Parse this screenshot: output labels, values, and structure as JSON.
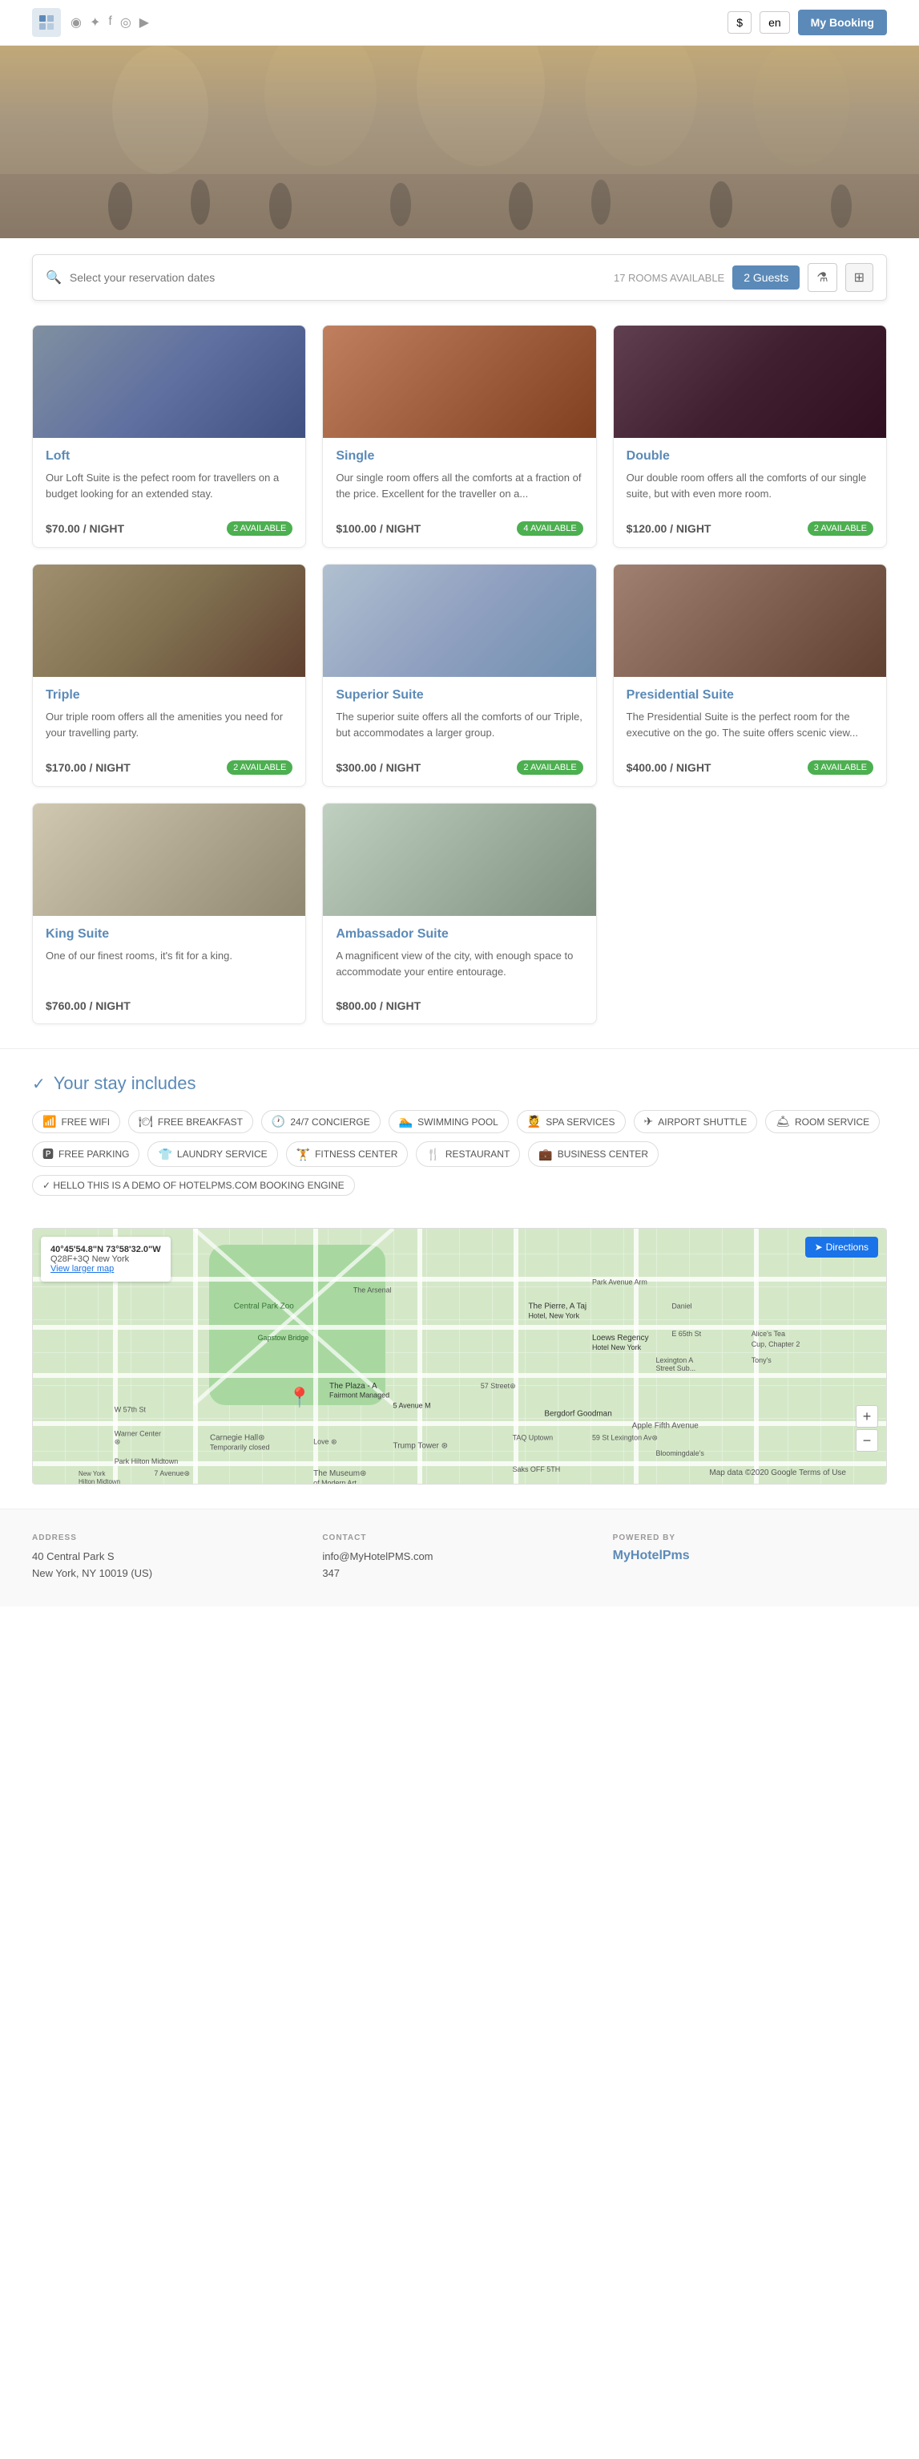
{
  "header": {
    "currency": "$",
    "language": "en",
    "booking_label": "My Booking",
    "social_icons": [
      "◉",
      "✦",
      "f",
      "◎",
      "▶"
    ]
  },
  "search": {
    "placeholder": "Select your reservation dates",
    "rooms_available": "17 ROOMS AVAILABLE",
    "guests_label": "2 Guests"
  },
  "rooms": [
    {
      "name": "Loft",
      "description": "Our Loft Suite is the pefect room for travellers on a budget looking for an extended stay.",
      "price": "$70.00 / NIGHT",
      "available": "2 AVAILABLE",
      "img_class": "img-loft"
    },
    {
      "name": "Single",
      "description": "Our single room offers all the comforts at a fraction of the price. Excellent for the traveller on a...",
      "price": "$100.00 / NIGHT",
      "available": "4 AVAILABLE",
      "img_class": "img-single"
    },
    {
      "name": "Double",
      "description": "Our double room offers all the comforts of our single suite, but with even more room.",
      "price": "$120.00 / NIGHT",
      "available": "2 AVAILABLE",
      "img_class": "img-double"
    },
    {
      "name": "Triple",
      "description": "Our triple room offers all the amenities you need for your travelling party.",
      "price": "$170.00 / NIGHT",
      "available": "2 AVAILABLE",
      "img_class": "img-triple"
    },
    {
      "name": "Superior Suite",
      "description": "The superior suite offers all the comforts of our Triple, but accommodates a larger group.",
      "price": "$300.00 / NIGHT",
      "available": "2 AVAILABLE",
      "img_class": "img-superior"
    },
    {
      "name": "Presidential Suite",
      "description": "The Presidential Suite is the perfect room for the executive on the go. The suite offers scenic view...",
      "price": "$400.00 / NIGHT",
      "available": "3 AVAILABLE",
      "img_class": "img-presidential"
    },
    {
      "name": "King Suite",
      "description": "One of our finest rooms, it's fit for a king.",
      "price": "$760.00 / NIGHT",
      "available": "",
      "img_class": "img-king"
    },
    {
      "name": "Ambassador Suite",
      "description": "A magnificent view of the city, with enough space to accommodate your entire entourage.",
      "price": "$800.00 / NIGHT",
      "available": "",
      "img_class": "img-ambassador"
    }
  ],
  "includes": {
    "title": "Your stay includes",
    "amenities": [
      {
        "icon": "📶",
        "label": "FREE WIFI"
      },
      {
        "icon": "🍽",
        "label": "FREE BREAKFAST"
      },
      {
        "icon": "🕐",
        "label": "24/7 CONCIERGE"
      },
      {
        "icon": "🏊",
        "label": "SWIMMING POOL"
      },
      {
        "icon": "💆",
        "label": "SPA SERVICES"
      },
      {
        "icon": "✈",
        "label": "AIRPORT SHUTTLE"
      },
      {
        "icon": "🛎",
        "label": "ROOM SERVICE"
      },
      {
        "icon": "🅿",
        "label": "FREE PARKING"
      },
      {
        "icon": "👕",
        "label": "LAUNDRY SERVICE"
      },
      {
        "icon": "🏋",
        "label": "FITNESS CENTER"
      },
      {
        "icon": "🍴",
        "label": "RESTAURANT"
      },
      {
        "icon": "💼",
        "label": "BUSINESS CENTER"
      }
    ],
    "demo_label": "✓ HELLO THIS IS A DEMO OF HOTELPMS.COM BOOKING ENGINE"
  },
  "map": {
    "coords": "40°45'54.8\"N 73°58'32.0\"W",
    "plus_code": "Q28F+3Q New York",
    "view_larger": "View larger map",
    "directions_label": "Directions"
  },
  "footer": {
    "address_label": "ADDRESS",
    "address_line1": "40 Central Park S",
    "address_line2": "New York, NY 10019 (US)",
    "contact_label": "CONTACT",
    "contact_email": "info@MyHotelPMS.com",
    "contact_phone": "347",
    "powered_label": "POWERED BY",
    "brand": "MyHotelPms"
  }
}
